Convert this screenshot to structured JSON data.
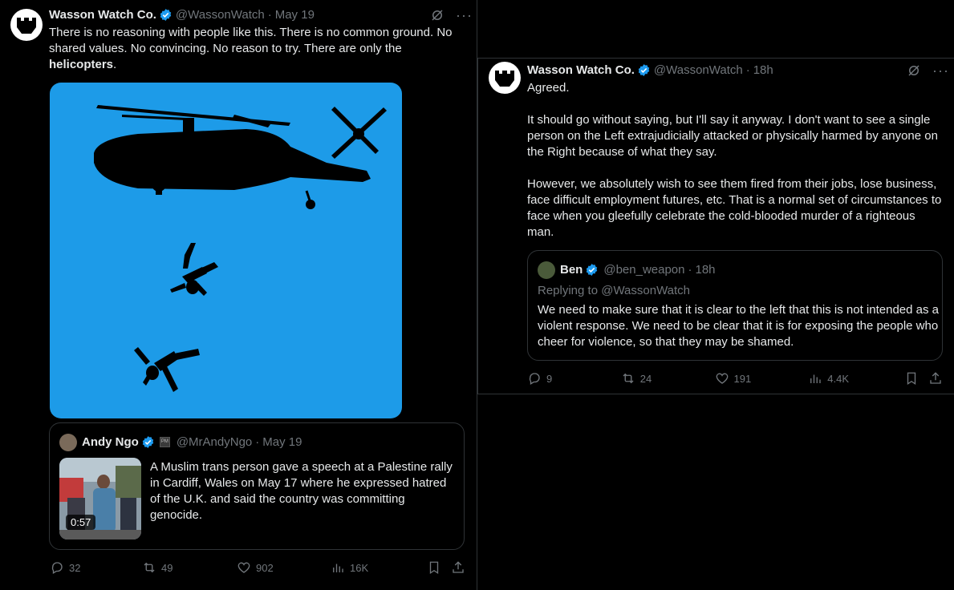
{
  "left_tweet": {
    "author_name": "Wasson Watch Co.",
    "handle": "@WassonWatch",
    "date": "May 19",
    "text_before": "There is no reasoning with people like this. There is no common ground. No shared values. No convincing. No reason to try. There are only the ",
    "text_bold": "helicopters",
    "text_after": ".",
    "quote": {
      "author_name": "Andy Ngo",
      "handle": "@MrAndyNgo",
      "date": "May 19",
      "text": "A Muslim trans person gave a speech at a Palestine rally in Cardiff, Wales on May 17 where he expressed hatred of the U.K. and said the country was committing genocide.",
      "video_duration": "0:57"
    },
    "stats": {
      "replies": "32",
      "reposts": "49",
      "likes": "902",
      "views": "16K"
    }
  },
  "right_tweet": {
    "author_name": "Wasson Watch Co.",
    "handle": "@WassonWatch",
    "date": "18h",
    "paragraph_1": "Agreed.",
    "paragraph_2": "It should go without saying, but I'll say it anyway. I don't want to see a single person on the Left extrajudicially attacked or physically harmed by anyone on the Right because of what they say.",
    "paragraph_3": "However, we absolutely wish to see them fired from their jobs, lose business, face difficult employment futures, etc. That is a normal set of circumstances to face when you gleefully celebrate the cold-blooded murder of a righteous man.",
    "quote": {
      "author_name": "Ben",
      "handle": "@ben_weapon",
      "date": "18h",
      "replying_to": "Replying to @WassonWatch",
      "text": "We need to make sure that it is clear to the left that this is not intended as a violent response. We need to be clear that it is for exposing the people who cheer for violence, so that they may be shamed."
    },
    "stats": {
      "replies": "9",
      "reposts": "24",
      "likes": "191",
      "views": "4.4K"
    }
  },
  "colors": {
    "accent": "#1d9bf0",
    "media_bg": "#1d9be8",
    "muted": "#71767b"
  },
  "icons": [
    "grok-icon",
    "more-icon",
    "reply-icon",
    "repost-icon",
    "like-icon",
    "views-icon",
    "bookmark-icon",
    "share-icon",
    "verified-icon"
  ]
}
